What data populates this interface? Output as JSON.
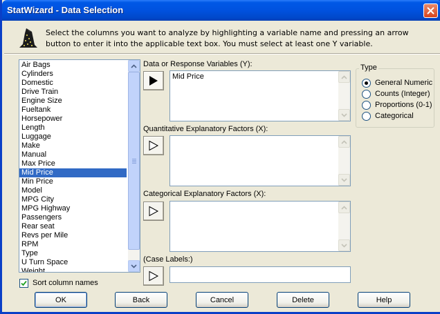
{
  "window": {
    "title": "StatWizard - Data Selection"
  },
  "instructions": {
    "line1": "Select the columns you want to analyze by highlighting a variable name and pressing an arrow",
    "line2": "button to enter it into the applicable text box.  You must select at least one Y variable."
  },
  "columns": [
    "Air Bags",
    "Cylinders",
    "Domestic",
    "Drive Train",
    "Engine Size",
    "Fueltank",
    "Horsepower",
    "Length",
    "Luggage",
    "Make",
    "Manual",
    "Max Price",
    "Mid Price",
    "Min Price",
    "Model",
    "MPG City",
    "MPG Highway",
    "Passengers",
    "Rear seat",
    "Revs per Mile",
    "RPM",
    "Type",
    "U Turn Space",
    "Weight"
  ],
  "selected_column": "Mid Price",
  "sort": {
    "label": "Sort column names",
    "checked": true
  },
  "fields": {
    "response": {
      "label": "Data or Response Variables (Y):",
      "value": "Mid Price"
    },
    "quantitative": {
      "label": "Quantitative Explanatory Factors (X):",
      "value": ""
    },
    "categorical": {
      "label": "Categorical Explanatory Factors (X):",
      "value": ""
    },
    "case_labels": {
      "label": "(Case Labels:)",
      "value": ""
    }
  },
  "type_group": {
    "title": "Type",
    "options": [
      "General Numeric",
      "Counts (Integer)",
      "Proportions (0-1)",
      "Categorical"
    ],
    "selected": "General Numeric"
  },
  "buttons": {
    "ok": "OK",
    "back": "Back",
    "cancel": "Cancel",
    "delete": "Delete",
    "help": "Help"
  }
}
